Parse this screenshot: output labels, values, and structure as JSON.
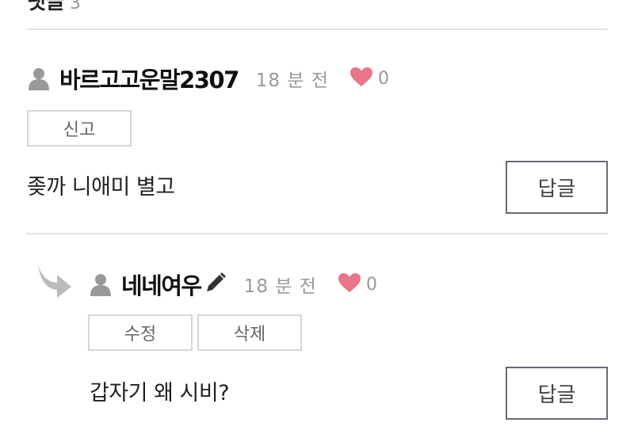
{
  "section": {
    "title": "댓글",
    "count": "3"
  },
  "comments": [
    {
      "username": "바르고고운말2307",
      "time": "18 분 전",
      "likes": "0",
      "actions": [
        "신고"
      ],
      "text": "좆까 니애미 별고",
      "reply_label": "답글"
    },
    {
      "username": "네네여우",
      "time": "18 분 전",
      "likes": "0",
      "actions": [
        "수정",
        "삭제"
      ],
      "text": "갑자기 왜 시비?",
      "reply_label": "답글"
    }
  ],
  "colors": {
    "heart": "#e8758a",
    "icon_gray": "#999999",
    "divider": "#e3e3e3",
    "reply_border": "#6a6a78"
  },
  "icons": [
    "user-icon",
    "heart-icon",
    "pencil-icon",
    "reply-arrow-icon"
  ]
}
